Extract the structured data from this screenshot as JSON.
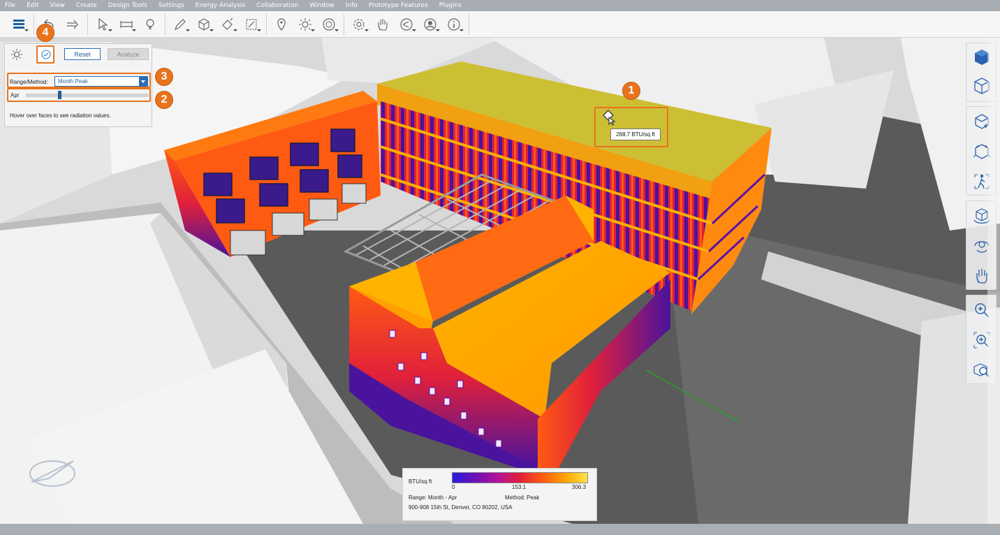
{
  "menu": {
    "items": [
      "File",
      "Edit",
      "View",
      "Create",
      "Design Tools",
      "Settings",
      "Energy Analysis",
      "Collaboration",
      "Window",
      "Info",
      "Prototype Features",
      "Plugins"
    ]
  },
  "toolbar": {
    "tools": [
      {
        "name": "browser-toggle-button",
        "icon": "list-icon"
      },
      {
        "name": "undo-button",
        "icon": "undo-icon"
      },
      {
        "name": "redo-button",
        "icon": "redo-icon"
      },
      {
        "name": "select-tool-button",
        "icon": "pointer-icon"
      },
      {
        "name": "measure-tool-button",
        "icon": "ruler-icon"
      },
      {
        "name": "hint-button",
        "icon": "lightbulb-icon"
      },
      {
        "name": "sketch-tool-button",
        "icon": "pencil-icon"
      },
      {
        "name": "modify-tool-button",
        "icon": "cube-plus-icon"
      },
      {
        "name": "paint-tool-button",
        "icon": "paint-icon"
      },
      {
        "name": "section-tool-button",
        "icon": "section-box-icon"
      },
      {
        "name": "location-button",
        "icon": "map-pin-icon"
      },
      {
        "name": "sun-settings-button",
        "icon": "sun-icon"
      },
      {
        "name": "camera-button",
        "icon": "camera-icon"
      },
      {
        "name": "settings-button",
        "icon": "gear-icon"
      },
      {
        "name": "hand-tool-button",
        "icon": "hand-icon"
      },
      {
        "name": "share-button",
        "icon": "share-icon"
      },
      {
        "name": "account-button",
        "icon": "user-icon"
      },
      {
        "name": "info-button",
        "icon": "info-icon"
      }
    ]
  },
  "panel": {
    "sun_icon": "sun-settings-icon",
    "check_icon": "check-circle-icon",
    "reset_label": "Reset",
    "analyze_label": "Analyze",
    "range_label": "Range/Method:",
    "range_value": "Month Peak",
    "month_label": "Apr",
    "month_slider_fraction": 0.27,
    "hint": "Hover over faces to see radiation values."
  },
  "callouts": [
    "1",
    "2",
    "3",
    "4"
  ],
  "tooltip": {
    "text": "268.7 BTU/sq ft"
  },
  "legend": {
    "unit": "BTU/sq ft",
    "min": "0",
    "mid": "153.1",
    "max": "306.3",
    "range": "Range: Month - Apr",
    "method": "Method: Peak",
    "address": "900-908 15th St, Denver, CO 80202, USA",
    "colors": [
      "#2a1be0",
      "#6a12b3",
      "#b3129a",
      "#e0203a",
      "#ff5a12",
      "#ffa200",
      "#ffe24a"
    ]
  },
  "navbar": {
    "groups": [
      [
        "viewcube-icon",
        "viewcube-wire-icon"
      ],
      [
        "home-view-icon",
        "perspective-icon",
        "walk-icon"
      ],
      [
        "orbit-icon",
        "look-around-icon",
        "pan-hand-icon"
      ],
      [
        "zoom-icon",
        "zoom-window-icon",
        "zoom-fit-icon"
      ]
    ]
  },
  "colors": {
    "accent": "#e8731d",
    "roof": "#cdbf34",
    "hot": "#ff5a12",
    "cold": "#3a1590"
  }
}
